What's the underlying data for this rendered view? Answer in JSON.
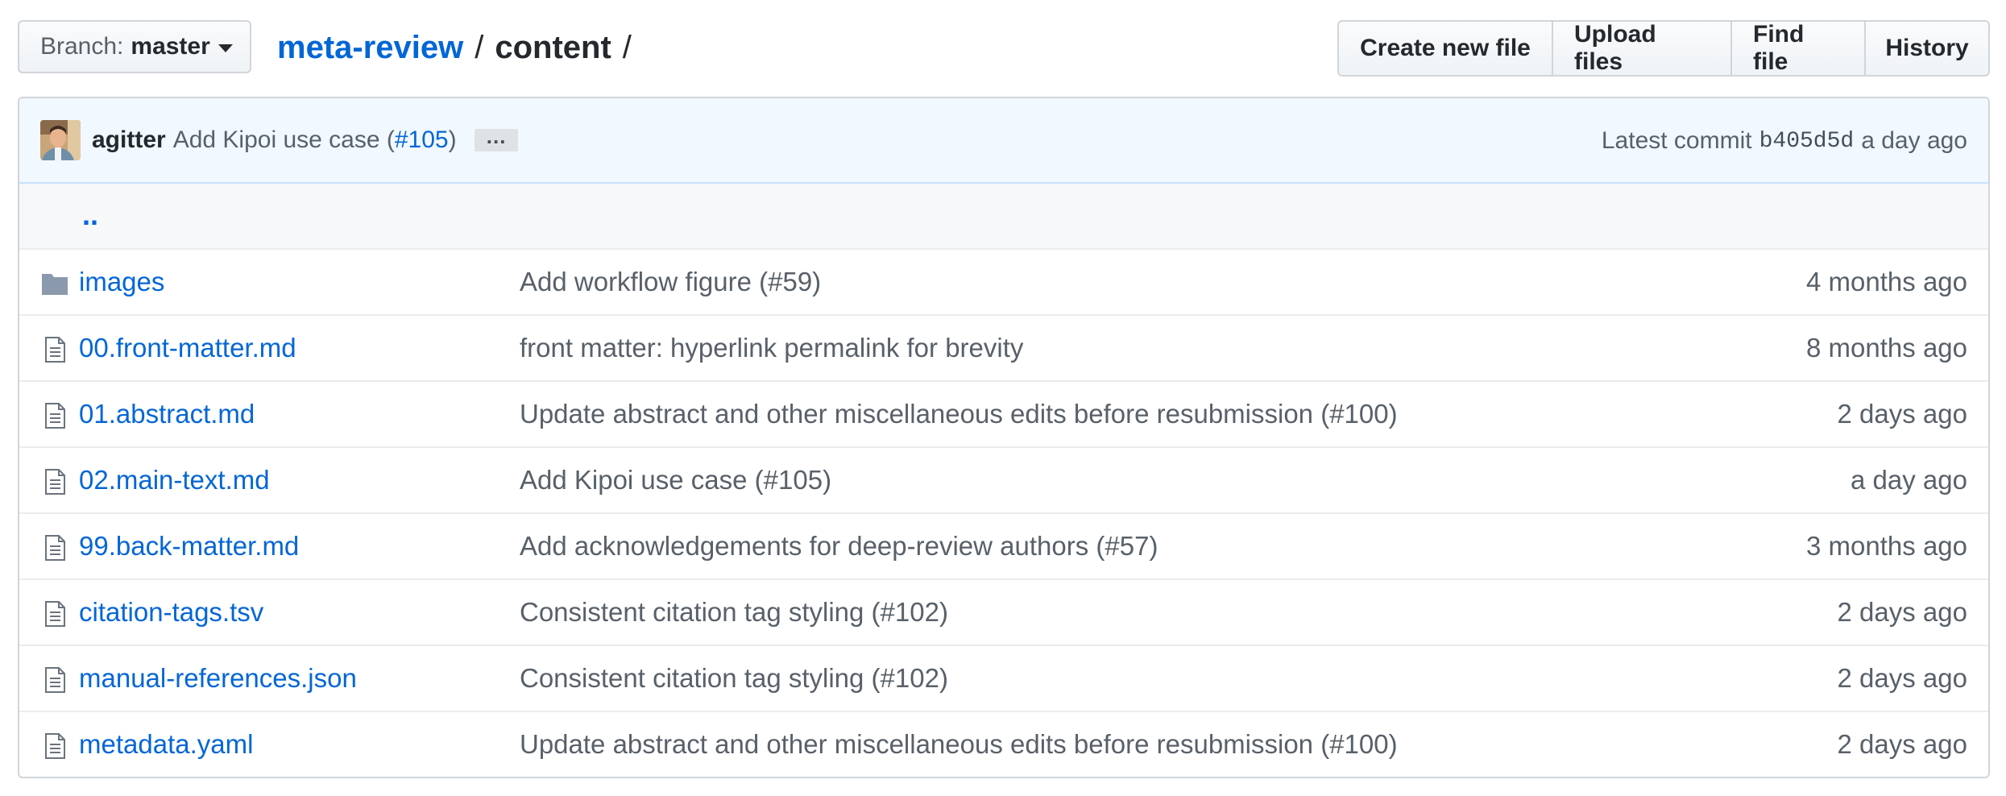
{
  "branch": {
    "label": "Branch:",
    "name": "master"
  },
  "breadcrumb": {
    "repo": "meta-review",
    "separator": "/",
    "current": "content",
    "trailing": "/"
  },
  "actions": {
    "create": "Create new file",
    "upload": "Upload files",
    "find": "Find file",
    "history": "History"
  },
  "commit": {
    "author": "agitter",
    "message_prefix": "Add Kipoi use case (",
    "pr_link": "#105",
    "message_suffix": ")",
    "ellipsis": "…",
    "latest_label": "Latest commit",
    "sha": "b405d5d",
    "age": "a day ago"
  },
  "updir": "..",
  "files": [
    {
      "type": "dir",
      "icon": "folder-icon",
      "name": "images",
      "message": "Add workflow figure (#59)",
      "age": "4 months ago"
    },
    {
      "type": "file",
      "icon": "file-icon",
      "name": "00.front-matter.md",
      "message": "front matter: hyperlink permalink for brevity",
      "age": "8 months ago"
    },
    {
      "type": "file",
      "icon": "file-icon",
      "name": "01.abstract.md",
      "message": "Update abstract and other miscellaneous edits before resubmission (#100)",
      "age": "2 days ago"
    },
    {
      "type": "file",
      "icon": "file-icon",
      "name": "02.main-text.md",
      "message": "Add Kipoi use case (#105)",
      "age": "a day ago"
    },
    {
      "type": "file",
      "icon": "file-icon",
      "name": "99.back-matter.md",
      "message": "Add acknowledgements for deep-review authors (#57)",
      "age": "3 months ago"
    },
    {
      "type": "file",
      "icon": "file-icon",
      "name": "citation-tags.tsv",
      "message": "Consistent citation tag styling (#102)",
      "age": "2 days ago"
    },
    {
      "type": "file",
      "icon": "file-icon",
      "name": "manual-references.json",
      "message": "Consistent citation tag styling (#102)",
      "age": "2 days ago"
    },
    {
      "type": "file",
      "icon": "file-icon",
      "name": "metadata.yaml",
      "message": "Update abstract and other miscellaneous edits before resubmission (#100)",
      "age": "2 days ago"
    }
  ],
  "colors": {
    "link": "#0366d6",
    "muted": "#586069",
    "commit_bg": "#f1f8ff",
    "icon": "#6a737d"
  }
}
